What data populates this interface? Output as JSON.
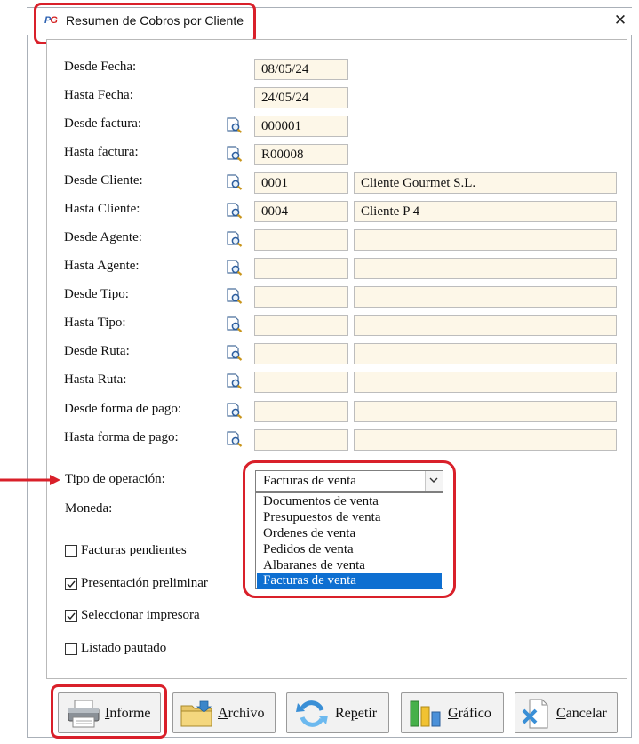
{
  "window": {
    "title": "Resumen de Cobros por Cliente",
    "logo_text": "PG",
    "close_glyph": "✕"
  },
  "filters": {
    "desde_fecha": {
      "label": "Desde Fecha:",
      "value": "08/05/24"
    },
    "hasta_fecha": {
      "label": "Hasta Fecha:",
      "value": "24/05/24"
    },
    "desde_factura": {
      "label": "Desde factura:",
      "value": "000001"
    },
    "hasta_factura": {
      "label": "Hasta factura:",
      "value": "R00008"
    },
    "desde_cliente": {
      "label": "Desde Cliente:",
      "code": "0001",
      "name": "Cliente Gourmet S.L."
    },
    "hasta_cliente": {
      "label": "Hasta Cliente:",
      "code": "0004",
      "name": "Cliente P 4"
    },
    "desde_agente": {
      "label": "Desde Agente:",
      "code": "",
      "name": ""
    },
    "hasta_agente": {
      "label": "Hasta Agente:",
      "code": "",
      "name": ""
    },
    "desde_tipo": {
      "label": "Desde Tipo:",
      "code": "",
      "name": ""
    },
    "hasta_tipo": {
      "label": "Hasta Tipo:",
      "code": "",
      "name": ""
    },
    "desde_ruta": {
      "label": "Desde Ruta:",
      "code": "",
      "name": ""
    },
    "hasta_ruta": {
      "label": "Hasta Ruta:",
      "code": "",
      "name": ""
    },
    "desde_forma_pago": {
      "label": "Desde forma de pago:",
      "code": "",
      "name": ""
    },
    "hasta_forma_pago": {
      "label": "Hasta forma de pago:",
      "code": "",
      "name": ""
    }
  },
  "tipo_operacion": {
    "label": "Tipo de operación:",
    "selected": "Facturas de venta",
    "options": [
      "Documentos de venta",
      "Presupuestos de venta",
      "Ordenes de venta",
      "Pedidos de venta",
      "Albaranes de venta",
      "Facturas de venta"
    ],
    "selected_index": 5
  },
  "moneda": {
    "label": "Moneda:"
  },
  "checkboxes": {
    "facturas_pendientes": {
      "label": "Facturas pendientes",
      "checked": false
    },
    "presentacion_preliminar": {
      "label": "Presentación preliminar",
      "checked": true
    },
    "seleccionar_impresora": {
      "label": "Seleccionar impresora",
      "checked": true
    },
    "listado_pautado": {
      "label": "Listado pautado",
      "checked": false
    }
  },
  "buttons": {
    "informe": {
      "mnemonic": "I",
      "rest": "nforme"
    },
    "archivo": {
      "mnemonic": "A",
      "rest": "rchivo"
    },
    "repetir": {
      "pre": "Re",
      "mnemonic": "p",
      "rest": "etir"
    },
    "grafico": {
      "mnemonic": "G",
      "rest": "ráfico"
    },
    "cancelar": {
      "mnemonic": "C",
      "rest": "ancelar"
    }
  },
  "colors": {
    "field_bg": "#fdf7e8",
    "highlight": "#d9202a",
    "selection": "#0e6fd1"
  }
}
